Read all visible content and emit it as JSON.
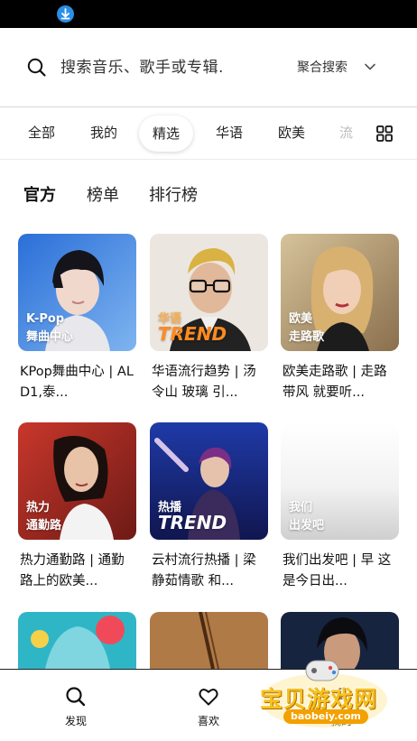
{
  "search": {
    "placeholder": "搜索音乐、歌手或专辑.",
    "mode_label": "聚合搜索"
  },
  "tabs": [
    "全部",
    "我的",
    "精选",
    "华语",
    "欧美",
    "流"
  ],
  "active_tab": "精选",
  "sub_tabs": [
    "官方",
    "榜单",
    "排行榜"
  ],
  "active_sub_tab": "官方",
  "playlists": [
    {
      "tag_line1": "K-Pop",
      "tag_line2": "舞曲中心",
      "title": "KPop舞曲中心 | ALD1,泰..."
    },
    {
      "tag_line1": "华语",
      "tag_line2": "TREND",
      "title": "华语流行趋势 | 汤令山 玻璃 引..."
    },
    {
      "tag_line1": "欧美",
      "tag_line2": "走路歌",
      "title": "欧美走路歌 | 走路带风 就要听..."
    },
    {
      "tag_line1": "热力",
      "tag_line2": "通勤路",
      "title": "热力通勤路 | 通勤路上的欧美..."
    },
    {
      "tag_line1": "热播",
      "tag_line2": "TREND",
      "title": "云村流行热播 | 梁静茹情歌 和..."
    },
    {
      "tag_line1": "我们",
      "tag_line2": "出发吧",
      "title": "我们出发吧 | 早 这是今日出..."
    }
  ],
  "bottom_nav": [
    {
      "label": "发现",
      "icon": "search-icon"
    },
    {
      "label": "喜欢",
      "icon": "heart-icon"
    },
    {
      "label": "我的",
      "icon": "profile-icon"
    }
  ],
  "watermark": {
    "text": "宝贝游戏网",
    "url": "baobeiy.com"
  },
  "colors": {
    "accent": "#2a8fe6",
    "trend_orange": "#ff8a1f",
    "watermark_yellow": "#f5c21f"
  }
}
